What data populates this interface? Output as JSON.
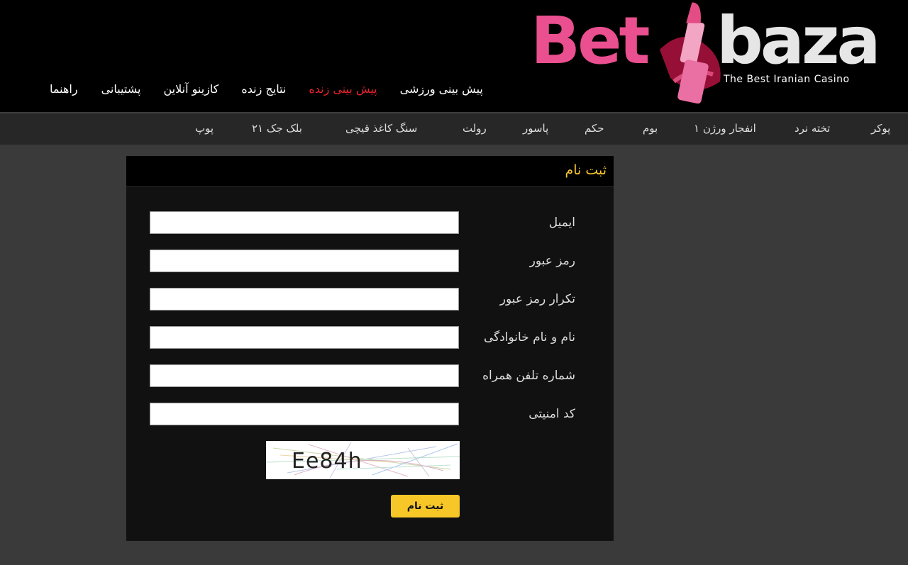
{
  "brand": {
    "name_part1": "Bet",
    "name_part2": "baza",
    "tagline": "The Best Iranian Casino",
    "primary_color": "#ea4f8f",
    "secondary_color": "#e6e6e6"
  },
  "top_nav": {
    "items": [
      {
        "label": "راهنما"
      },
      {
        "label": "پشتیبانی"
      },
      {
        "label": "کازینو آنلاین"
      },
      {
        "label": "نتایج زنده"
      },
      {
        "label": "پیش بینی زنده",
        "active": true
      },
      {
        "label": "پیش بینی ورزشی"
      }
    ],
    "active_color": "#e8212b"
  },
  "game_bar": {
    "items": [
      {
        "label": "پوکر"
      },
      {
        "label": "تخته نرد"
      },
      {
        "label": "انفجار ورژن ۱"
      },
      {
        "label": "بوم"
      },
      {
        "label": "حکم"
      },
      {
        "label": "پاسور"
      },
      {
        "label": "رولت"
      },
      {
        "label": "سنگ کاغذ قیچی"
      },
      {
        "label": "بلک جک ۲۱"
      },
      {
        "label": "پوپ"
      }
    ]
  },
  "register_form": {
    "title": "ثبت نام",
    "fields": [
      {
        "label": "ایمیل",
        "value": ""
      },
      {
        "label": "رمز عبور",
        "value": ""
      },
      {
        "label": "تکرار رمز عبور",
        "value": ""
      },
      {
        "label": "نام و نام خانوادگی",
        "value": ""
      },
      {
        "label": "شماره تلفن همراه",
        "value": ""
      },
      {
        "label": "کد امنیتی",
        "value": ""
      }
    ],
    "captcha_text": "Ee84h",
    "submit_label": "ثبت نام",
    "title_color": "#f4c430",
    "button_color": "#f7c728"
  }
}
